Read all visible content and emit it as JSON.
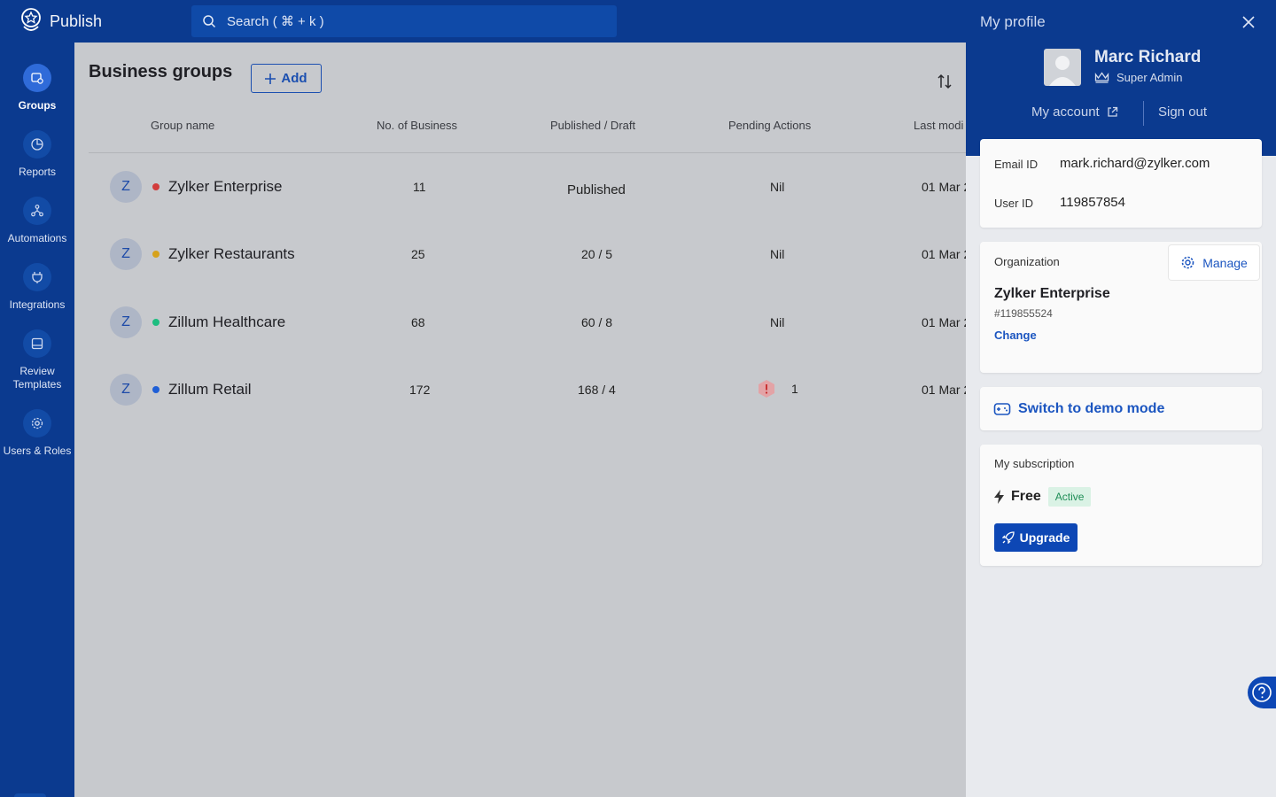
{
  "app": {
    "name": "Publish"
  },
  "search": {
    "placeholder": "Search ( ⌘ + k )"
  },
  "nav": {
    "items": [
      {
        "label": "Groups",
        "icon": "groups-icon",
        "active": true
      },
      {
        "label": "Reports",
        "icon": "reports-icon"
      },
      {
        "label": "Automations",
        "icon": "automations-icon"
      },
      {
        "label": "Integrations",
        "icon": "integrations-icon"
      },
      {
        "label": "Review Templates",
        "icon": "review-templates-icon"
      },
      {
        "label": "Users & Roles",
        "icon": "users-roles-icon"
      }
    ]
  },
  "main": {
    "title": "Business groups",
    "add_label": "Add",
    "columns": [
      "Group name",
      "No. of Business",
      "Published / Draft",
      "Pending Actions",
      "Last modi"
    ],
    "rows": [
      {
        "avatar": "Z",
        "name": "Zylker Enterprise",
        "dot": "#d23c3c",
        "count": "11",
        "published": "Published",
        "pending": "Nil",
        "modified": "01 Mar 2"
      },
      {
        "avatar": "Z",
        "name": "Zylker Restaurants",
        "dot": "#d6a21c",
        "count": "25",
        "published": "20 / 5",
        "pending": "Nil",
        "modified": "01 Mar 2"
      },
      {
        "avatar": "Z",
        "name": "Zillum Healthcare",
        "dot": "#1ebd80",
        "count": "68",
        "published": "60 / 8",
        "pending": "Nil",
        "modified": "01 Mar 2"
      },
      {
        "avatar": "Z",
        "name": "Zillum Retail",
        "dot": "#1f5fd6",
        "count": "172",
        "published": "168 / 4",
        "pending": "1",
        "pending_warning": true,
        "modified": "01 Mar 2"
      }
    ]
  },
  "profile": {
    "title": "My profile",
    "name": "Marc Richard",
    "role": "Super Admin",
    "my_account": "My account",
    "sign_out": "Sign out",
    "email_label": "Email ID",
    "email": "mark.richard@zylker.com",
    "user_id_label": "User ID",
    "user_id": "119857854",
    "org_label": "Organization",
    "manage_label": "Manage",
    "org_name": "Zylker Enterprise",
    "org_number": "#119855524",
    "change_label": "Change",
    "demo_label": "Switch to demo mode",
    "subscription_label": "My subscription",
    "plan": "Free",
    "plan_status": "Active",
    "upgrade_label": "Upgrade"
  },
  "colors": {
    "brand": "#0b3a8f",
    "accent": "#1b55c0",
    "overlay": "#c7c9cd"
  }
}
